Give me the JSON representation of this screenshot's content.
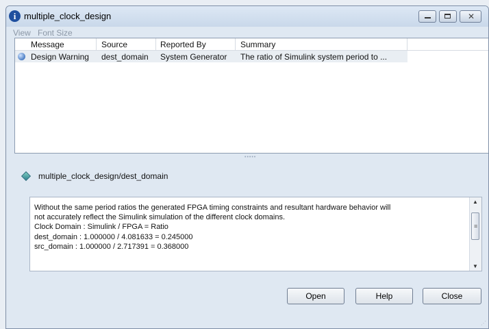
{
  "window": {
    "title": "multiple_clock_design",
    "info_glyph": "i",
    "close_glyph": "✕"
  },
  "menu": {
    "view": "View",
    "font_size": "Font Size"
  },
  "table": {
    "headers": [
      "Message",
      "Source",
      "Reported By",
      "Summary"
    ],
    "rows": [
      {
        "message": "Design Warning",
        "source": "dest_domain",
        "reported_by": "System Generator",
        "summary": "The ratio of Simulink system period to ..."
      }
    ]
  },
  "splitter": "•••••",
  "detail": {
    "path": "multiple_clock_design/dest_domain",
    "text": "Without the same period ratios the generated FPGA timing constraints and resultant hardware behavior will\nnot accurately reflect the Simulink simulation of the different clock domains.\nClock Domain : Simulink / FPGA = Ratio\ndest_domain : 1.000000 / 4.081633 = 0.245000\nsrc_domain : 1.000000 / 2.717391 = 0.368000",
    "scroll_up": "▲",
    "scroll_down": "▼",
    "thumb_grip": "≡"
  },
  "buttons": {
    "open": "Open",
    "help": "Help",
    "close": "Close"
  },
  "resize_grip": "⋰",
  "colors": {
    "title_bar": "#c9d8ea",
    "row_highlight": "#e9eef3",
    "menu_disabled": "#8b97a6"
  }
}
